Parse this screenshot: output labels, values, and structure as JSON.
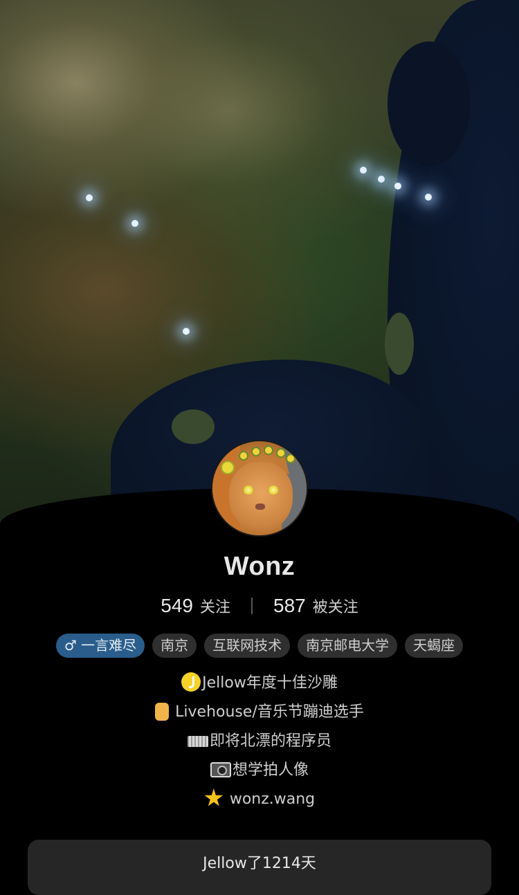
{
  "profile": {
    "name": "Wonz",
    "following_count": "549",
    "following_label": "关注",
    "followers_count": "587",
    "followers_label": "被关注"
  },
  "tags": [
    "♂ 一言难尽",
    "南京",
    "互联网技术",
    "南京邮电大学",
    "天蝎座"
  ],
  "bio": [
    {
      "icon": "jellow-badge-icon",
      "text": "Jellow年度十佳沙雕"
    },
    {
      "icon": "rock-hand-icon",
      "text": " Livehouse/音乐节蹦迪选手"
    },
    {
      "icon": "keyboard-icon",
      "text": "即将北漂的程序员"
    },
    {
      "icon": "camera-icon",
      "text": "想学拍人像"
    },
    {
      "icon": "star-icon",
      "text": " wonz.wang"
    }
  ],
  "footer": {
    "days_label": "Jellow了1214天"
  },
  "colors": {
    "gender_tag": "#2a5d8c",
    "tag_bg": "#2f2f2f",
    "button_bg": "#262626"
  }
}
